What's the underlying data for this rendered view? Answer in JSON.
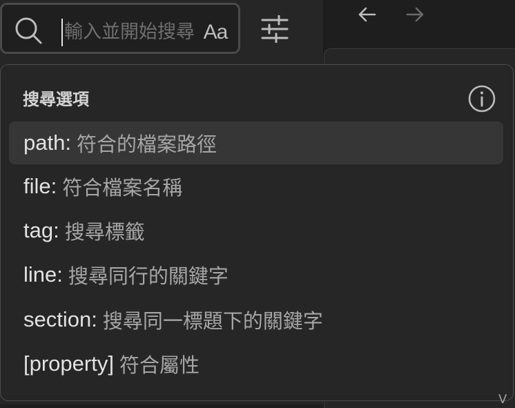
{
  "search": {
    "placeholder": "輸入並開始搜尋",
    "match_case_label": "Aa"
  },
  "popup": {
    "title": "搜尋選項",
    "options": [
      {
        "key": "path:",
        "description": "符合的檔案路徑",
        "highlighted": true
      },
      {
        "key": "file:",
        "description": "符合檔案名稱",
        "highlighted": false
      },
      {
        "key": "tag:",
        "description": "搜尋標籤",
        "highlighted": false
      },
      {
        "key": "line:",
        "description": "搜尋同行的關鍵字",
        "highlighted": false
      },
      {
        "key": "section:",
        "description": "搜尋同一標題下的關鍵字",
        "highlighted": false
      },
      {
        "key": "[property]",
        "description": "符合屬性",
        "highlighted": false
      }
    ]
  },
  "icons": {
    "search": "search-icon",
    "filter": "sliders-icon",
    "info": "info-icon",
    "back": "arrow-left-icon",
    "forward": "arrow-right-icon"
  },
  "colors": {
    "background": "#1e1e1e",
    "panel": "#262626",
    "highlight": "#363636",
    "text": "#dadada",
    "muted": "#a6a6a6"
  },
  "edge_glyph": "V"
}
